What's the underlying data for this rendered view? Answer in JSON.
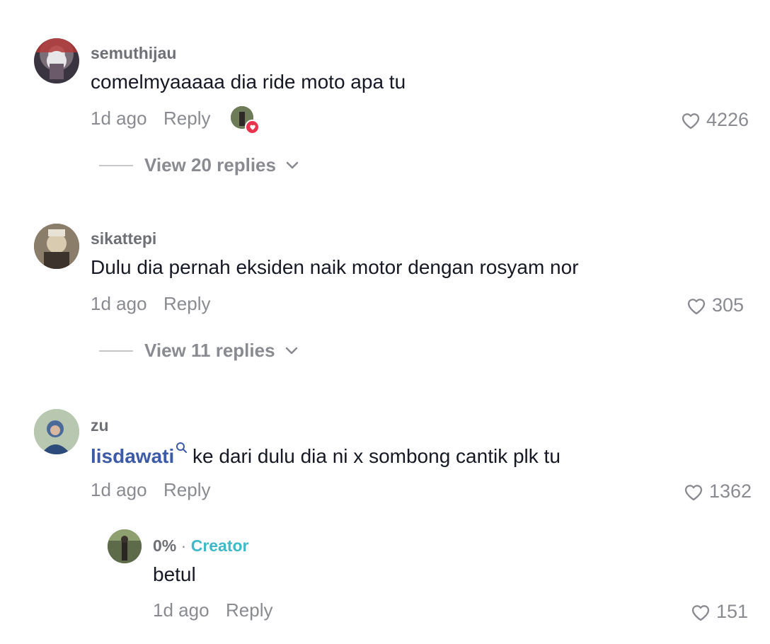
{
  "colors": {
    "text": "#161823",
    "muted": "#8a8b91",
    "mention": "#3d5aa8",
    "creator": "#3fb8c8",
    "heart_badge": "#e8354f"
  },
  "comments": [
    {
      "username": "semuthijau",
      "text": "comelmyaaaaa dia ride moto apa tu",
      "time": "1d ago",
      "reply_label": "Reply",
      "likes": "4226",
      "creator_liked": true,
      "view_replies": "View 20 replies",
      "avatar_icon": "avatar-photo"
    },
    {
      "username": "sikattepi",
      "text": "Dulu dia pernah eksiden naik motor dengan rosyam nor",
      "time": "1d ago",
      "reply_label": "Reply",
      "likes": "305",
      "view_replies": "View 11 replies",
      "avatar_icon": "avatar-photo"
    },
    {
      "username": "zu",
      "mention": "lisdawati",
      "mention_icon": "search-icon",
      "text": " ke dari dulu dia ni x sombong cantik plk tu",
      "time": "1d ago",
      "reply_label": "Reply",
      "likes": "1362",
      "avatar_icon": "avatar-photo",
      "replies": [
        {
          "username": "0%",
          "separator": "·",
          "badge": "Creator",
          "text": "betul",
          "time": "1d ago",
          "reply_label": "Reply",
          "likes": "151",
          "avatar_icon": "avatar-photo"
        }
      ]
    }
  ],
  "icons": {
    "like": "heart-outline-icon",
    "expand": "chevron-down-icon",
    "liked_badge": "heart-filled-icon"
  }
}
